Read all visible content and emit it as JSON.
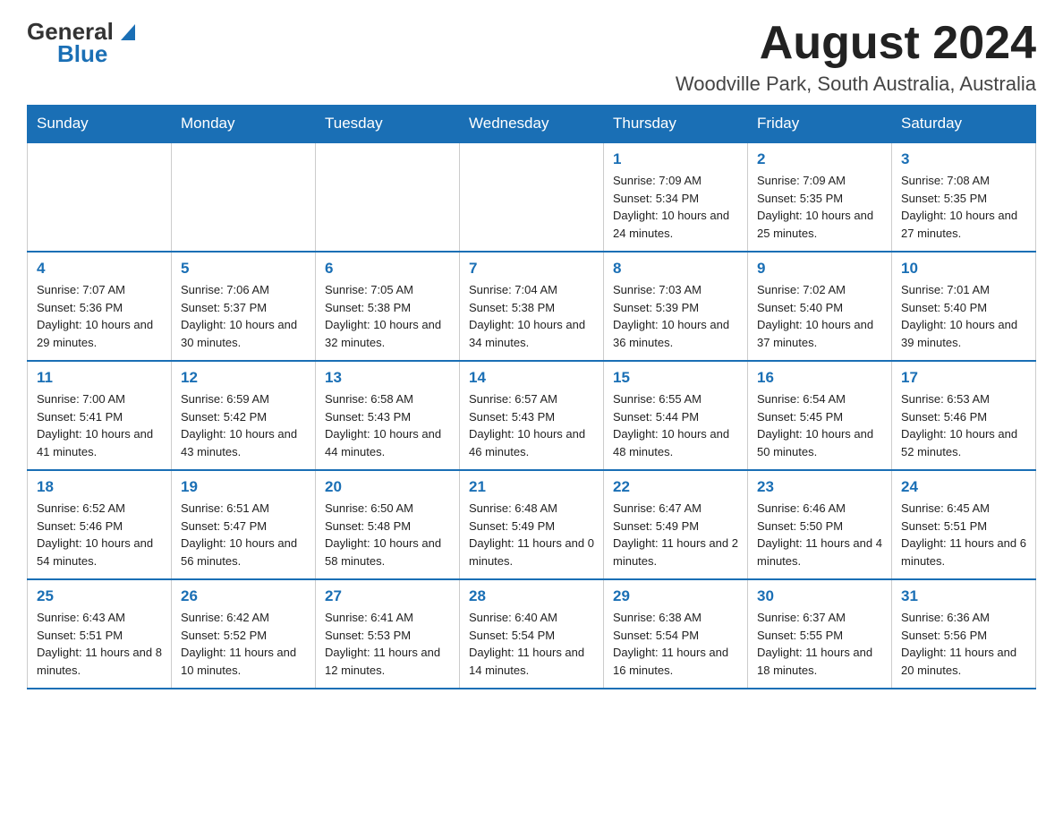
{
  "header": {
    "logo_general": "General",
    "logo_blue": "Blue",
    "month_year": "August 2024",
    "location": "Woodville Park, South Australia, Australia"
  },
  "weekdays": [
    "Sunday",
    "Monday",
    "Tuesday",
    "Wednesday",
    "Thursday",
    "Friday",
    "Saturday"
  ],
  "weeks": [
    [
      {
        "day": "",
        "info": ""
      },
      {
        "day": "",
        "info": ""
      },
      {
        "day": "",
        "info": ""
      },
      {
        "day": "",
        "info": ""
      },
      {
        "day": "1",
        "info": "Sunrise: 7:09 AM\nSunset: 5:34 PM\nDaylight: 10 hours and 24 minutes."
      },
      {
        "day": "2",
        "info": "Sunrise: 7:09 AM\nSunset: 5:35 PM\nDaylight: 10 hours and 25 minutes."
      },
      {
        "day": "3",
        "info": "Sunrise: 7:08 AM\nSunset: 5:35 PM\nDaylight: 10 hours and 27 minutes."
      }
    ],
    [
      {
        "day": "4",
        "info": "Sunrise: 7:07 AM\nSunset: 5:36 PM\nDaylight: 10 hours and 29 minutes."
      },
      {
        "day": "5",
        "info": "Sunrise: 7:06 AM\nSunset: 5:37 PM\nDaylight: 10 hours and 30 minutes."
      },
      {
        "day": "6",
        "info": "Sunrise: 7:05 AM\nSunset: 5:38 PM\nDaylight: 10 hours and 32 minutes."
      },
      {
        "day": "7",
        "info": "Sunrise: 7:04 AM\nSunset: 5:38 PM\nDaylight: 10 hours and 34 minutes."
      },
      {
        "day": "8",
        "info": "Sunrise: 7:03 AM\nSunset: 5:39 PM\nDaylight: 10 hours and 36 minutes."
      },
      {
        "day": "9",
        "info": "Sunrise: 7:02 AM\nSunset: 5:40 PM\nDaylight: 10 hours and 37 minutes."
      },
      {
        "day": "10",
        "info": "Sunrise: 7:01 AM\nSunset: 5:40 PM\nDaylight: 10 hours and 39 minutes."
      }
    ],
    [
      {
        "day": "11",
        "info": "Sunrise: 7:00 AM\nSunset: 5:41 PM\nDaylight: 10 hours and 41 minutes."
      },
      {
        "day": "12",
        "info": "Sunrise: 6:59 AM\nSunset: 5:42 PM\nDaylight: 10 hours and 43 minutes."
      },
      {
        "day": "13",
        "info": "Sunrise: 6:58 AM\nSunset: 5:43 PM\nDaylight: 10 hours and 44 minutes."
      },
      {
        "day": "14",
        "info": "Sunrise: 6:57 AM\nSunset: 5:43 PM\nDaylight: 10 hours and 46 minutes."
      },
      {
        "day": "15",
        "info": "Sunrise: 6:55 AM\nSunset: 5:44 PM\nDaylight: 10 hours and 48 minutes."
      },
      {
        "day": "16",
        "info": "Sunrise: 6:54 AM\nSunset: 5:45 PM\nDaylight: 10 hours and 50 minutes."
      },
      {
        "day": "17",
        "info": "Sunrise: 6:53 AM\nSunset: 5:46 PM\nDaylight: 10 hours and 52 minutes."
      }
    ],
    [
      {
        "day": "18",
        "info": "Sunrise: 6:52 AM\nSunset: 5:46 PM\nDaylight: 10 hours and 54 minutes."
      },
      {
        "day": "19",
        "info": "Sunrise: 6:51 AM\nSunset: 5:47 PM\nDaylight: 10 hours and 56 minutes."
      },
      {
        "day": "20",
        "info": "Sunrise: 6:50 AM\nSunset: 5:48 PM\nDaylight: 10 hours and 58 minutes."
      },
      {
        "day": "21",
        "info": "Sunrise: 6:48 AM\nSunset: 5:49 PM\nDaylight: 11 hours and 0 minutes."
      },
      {
        "day": "22",
        "info": "Sunrise: 6:47 AM\nSunset: 5:49 PM\nDaylight: 11 hours and 2 minutes."
      },
      {
        "day": "23",
        "info": "Sunrise: 6:46 AM\nSunset: 5:50 PM\nDaylight: 11 hours and 4 minutes."
      },
      {
        "day": "24",
        "info": "Sunrise: 6:45 AM\nSunset: 5:51 PM\nDaylight: 11 hours and 6 minutes."
      }
    ],
    [
      {
        "day": "25",
        "info": "Sunrise: 6:43 AM\nSunset: 5:51 PM\nDaylight: 11 hours and 8 minutes."
      },
      {
        "day": "26",
        "info": "Sunrise: 6:42 AM\nSunset: 5:52 PM\nDaylight: 11 hours and 10 minutes."
      },
      {
        "day": "27",
        "info": "Sunrise: 6:41 AM\nSunset: 5:53 PM\nDaylight: 11 hours and 12 minutes."
      },
      {
        "day": "28",
        "info": "Sunrise: 6:40 AM\nSunset: 5:54 PM\nDaylight: 11 hours and 14 minutes."
      },
      {
        "day": "29",
        "info": "Sunrise: 6:38 AM\nSunset: 5:54 PM\nDaylight: 11 hours and 16 minutes."
      },
      {
        "day": "30",
        "info": "Sunrise: 6:37 AM\nSunset: 5:55 PM\nDaylight: 11 hours and 18 minutes."
      },
      {
        "day": "31",
        "info": "Sunrise: 6:36 AM\nSunset: 5:56 PM\nDaylight: 11 hours and 20 minutes."
      }
    ]
  ]
}
